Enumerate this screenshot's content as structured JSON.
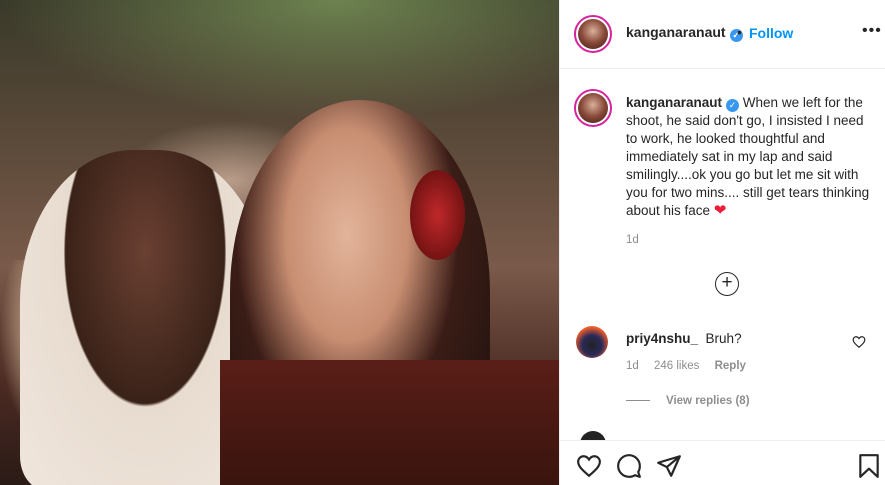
{
  "post": {
    "username": "kanganaranaut",
    "follow_label": "Follow",
    "dot": "•",
    "more_label": "•••"
  },
  "caption": {
    "username": "kanganaranaut",
    "text": "When we left for the shoot, he said don't go, I insisted I need to work, he looked thoughtful and immediately sat in my lap and said smilingly....ok you go but let me sit with you for two mins.... still get tears thinking about his face",
    "time": "1d",
    "emoji": "❤"
  },
  "load_more": "+",
  "comment": {
    "username": "priy4nshu_",
    "text": "Bruh?",
    "time": "1d",
    "likes": "246 likes",
    "reply_label": "Reply",
    "view_replies": "View replies (8)"
  },
  "colors": {
    "accent": "#0095f6",
    "verified": "#3897f0",
    "muted": "#8e8e8e",
    "heart": "#ed1c3a"
  },
  "icons": [
    "verified-badge-icon",
    "more-options-icon",
    "load-more-icon",
    "like-comment-icon",
    "heart-icon",
    "comment-icon",
    "share-icon",
    "bookmark-icon"
  ]
}
